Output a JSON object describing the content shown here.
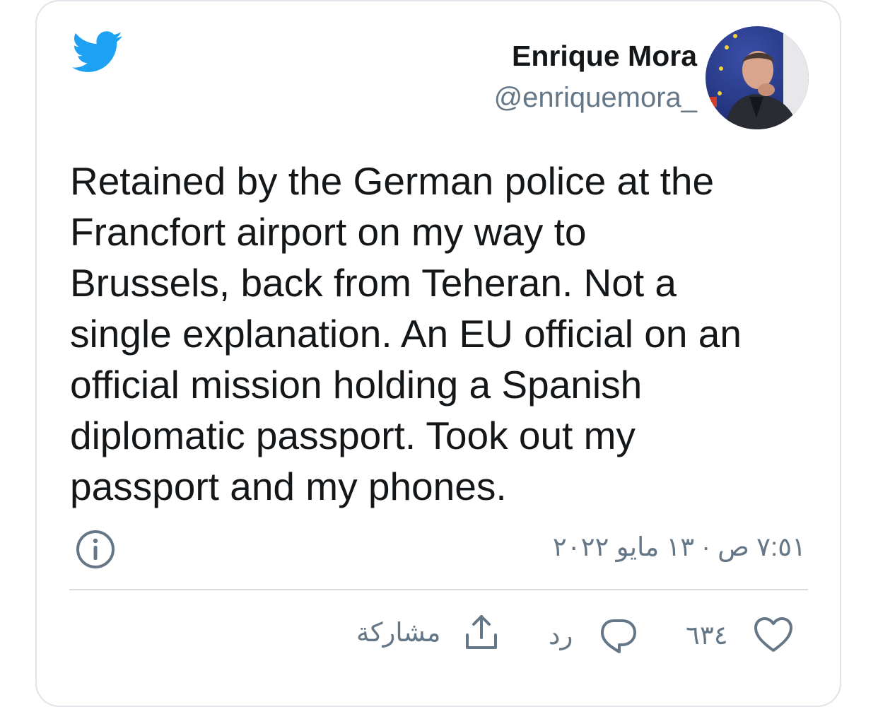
{
  "brand": {
    "icon": "twitter-bird-icon",
    "color": "#1da1f2"
  },
  "user": {
    "name": "Enrique Mora",
    "handle": "@enriquemora_"
  },
  "tweet": {
    "text": "Retained by the German police at the\nFrancfort airport on my way to\nBrussels, back from Teheran. Not a\nsingle explanation. An EU official on an\nofficial mission holding a Spanish\ndiplomatic passport. Took out my\npassport and my phones."
  },
  "meta": {
    "timestamp": "٧:٥١ ص · ١٣ مايو ٢٠٢٢",
    "info_icon": "info-icon"
  },
  "actions": {
    "like": {
      "icon": "heart-icon",
      "count": "٦٣٤"
    },
    "reply": {
      "icon": "comment-icon",
      "label": "رد"
    },
    "share": {
      "icon": "share-icon",
      "label": "مشاركة"
    }
  },
  "colors": {
    "text": "#14171a",
    "secondary": "#657786",
    "border": "#dfe3e8"
  }
}
